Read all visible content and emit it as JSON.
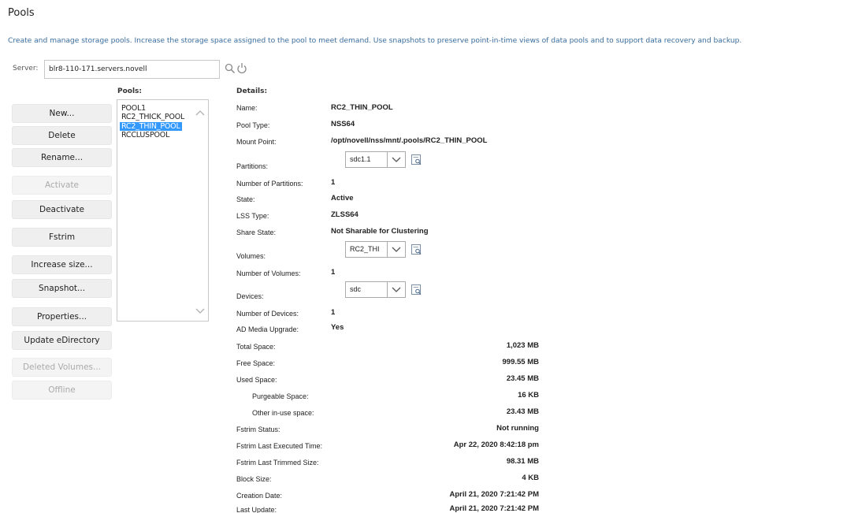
{
  "page": {
    "title": "Pools",
    "description": "Create and manage storage pools. Increase the storage space assigned to the pool to meet demand. Use snapshots to preserve point-in-time views of data pools and to support data recovery and backup."
  },
  "server": {
    "label": "Server:",
    "value": "blr8-110-171.servers.novell"
  },
  "headers": {
    "pools": "Pools:",
    "details": "Details:"
  },
  "actions": [
    {
      "label": "New...",
      "enabled": true
    },
    {
      "label": "Delete",
      "enabled": true
    },
    {
      "label": "Rename...",
      "enabled": true
    },
    {
      "label": "Activate",
      "enabled": false
    },
    {
      "label": "Deactivate",
      "enabled": true
    },
    {
      "label": "Fstrim",
      "enabled": true
    },
    {
      "label": "Increase size...",
      "enabled": true
    },
    {
      "label": "Snapshot...",
      "enabled": true
    },
    {
      "label": "Properties...",
      "enabled": true
    },
    {
      "label": "Update eDirectory",
      "enabled": true
    },
    {
      "label": "Deleted Volumes...",
      "enabled": false
    },
    {
      "label": "Offline",
      "enabled": false
    }
  ],
  "pools": [
    {
      "name": "POOL1",
      "selected": false
    },
    {
      "name": "RC2_THICK_POOL",
      "selected": false
    },
    {
      "name": "RC2_THIN_POOL",
      "selected": true
    },
    {
      "name": "RCCLUSPOOL",
      "selected": false
    }
  ],
  "details": {
    "name": {
      "label": "Name:",
      "value": "RC2_THIN_POOL"
    },
    "pool_type": {
      "label": "Pool Type:",
      "value": "NSS64"
    },
    "mount_point": {
      "label": "Mount Point:",
      "value": "/opt/novell/nss/mnt/.pools/RC2_THIN_POOL"
    },
    "partitions": {
      "label": "Partitions:",
      "selected": "sdc1.1"
    },
    "num_partitions": {
      "label": "Number of Partitions:",
      "value": "1"
    },
    "state": {
      "label": "State:",
      "value": "Active"
    },
    "lss_type": {
      "label": "LSS Type:",
      "value": "ZLSS64"
    },
    "share_state": {
      "label": "Share State:",
      "value": "Not Sharable for Clustering"
    },
    "volumes": {
      "label": "Volumes:",
      "selected": "RC2_THI"
    },
    "num_volumes": {
      "label": "Number of Volumes:",
      "value": "1"
    },
    "devices": {
      "label": "Devices:",
      "selected": "sdc"
    },
    "num_devices": {
      "label": "Number of Devices:",
      "value": "1"
    },
    "ad_media": {
      "label": "AD Media Upgrade:",
      "value": "Yes"
    },
    "total_space": {
      "label": "Total Space:",
      "value": "1,023 MB"
    },
    "free_space": {
      "label": "Free Space:",
      "value": "999.55 MB"
    },
    "used_space": {
      "label": "Used Space:",
      "value": "23.45 MB"
    },
    "purgeable_space": {
      "label": "Purgeable Space:",
      "value": "16 KB"
    },
    "other_inuse": {
      "label": "Other in-use space:",
      "value": "23.43 MB"
    },
    "fstrim_status": {
      "label": "Fstrim Status:",
      "value": "Not running"
    },
    "fstrim_last_time": {
      "label": "Fstrim Last Executed Time:",
      "value": "Apr 22, 2020 8:42:18 pm"
    },
    "fstrim_last_size": {
      "label": "Fstrim Last Trimmed Size:",
      "value": "98.31 MB"
    },
    "block_size": {
      "label": "Block Size:",
      "value": "4 KB"
    },
    "creation_date": {
      "label": "Creation Date:",
      "value": "April 21, 2020 7:21:42 PM"
    },
    "last_update": {
      "label": "Last Update:",
      "value": "April 21, 2020 7:21:42 PM"
    }
  },
  "icons": {
    "search": "magnifier-icon",
    "refresh": "power-refresh-icon",
    "dropdown": "chevron-down-icon",
    "info": "details-lookup-icon"
  }
}
